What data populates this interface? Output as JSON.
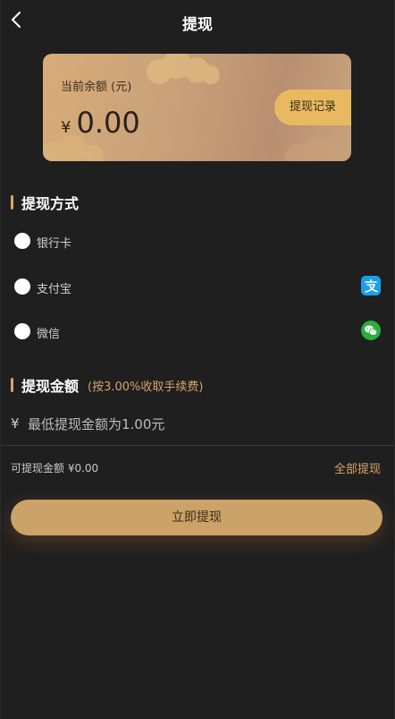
{
  "header": {
    "title": "提现"
  },
  "balance": {
    "label": "当前余额 (元)",
    "currency": "¥",
    "amount": "0.00",
    "record_button": "提现记录"
  },
  "methods_section": {
    "title": "提现方式"
  },
  "methods": [
    {
      "label": "银行卡",
      "icon": ""
    },
    {
      "label": "支付宝",
      "icon": "alipay-icon"
    },
    {
      "label": "微信",
      "icon": "wechat-icon"
    }
  ],
  "amount_section": {
    "title": "提现金额",
    "note": "(按3.00%收取手续费)"
  },
  "amount_input": {
    "currency": "¥",
    "placeholder": "最低提现金额为1.00元"
  },
  "available": {
    "text": "可提现金额 ¥0.00",
    "withdraw_all": "全部提现"
  },
  "submit": {
    "label": "立即提现"
  },
  "colors": {
    "background": "#1f1f1f",
    "accent": "#d6a56a",
    "card_gold": "#c9a27a",
    "button": "#cba267",
    "alipay": "#1a9fe8",
    "wechat": "#2aae3c"
  }
}
